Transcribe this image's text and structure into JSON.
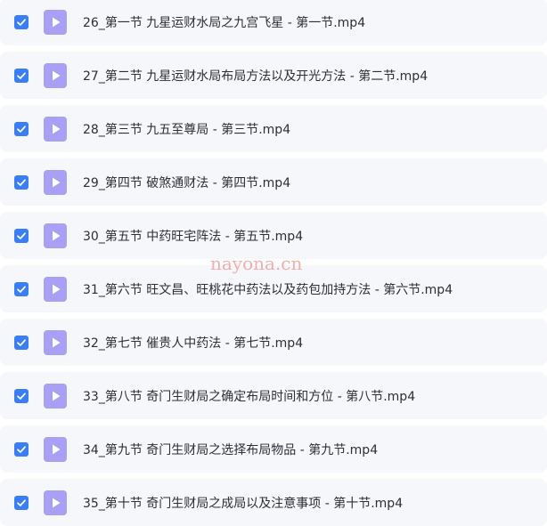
{
  "colors": {
    "row_background": "#f6f7fb",
    "checkbox_checked": "#3a7ef6",
    "video_icon": "#a99ff5",
    "text": "#2b2f36",
    "watermark": "#f3a0a0"
  },
  "files": [
    {
      "name": "26_第一节 九星运财水局之九宫飞星 - 第一节.mp4",
      "checked": true,
      "icon": "video-file-icon"
    },
    {
      "name": "27_第二节 九星运财水局布局方法以及开光方法 - 第二节.mp4",
      "checked": true,
      "icon": "video-file-icon"
    },
    {
      "name": "28_第三节 九五至尊局 - 第三节.mp4",
      "checked": true,
      "icon": "video-file-icon"
    },
    {
      "name": "29_第四节 破煞通财法 - 第四节.mp4",
      "checked": true,
      "icon": "video-file-icon"
    },
    {
      "name": "30_第五节 中药旺宅阵法 - 第五节.mp4",
      "checked": true,
      "icon": "video-file-icon"
    },
    {
      "name": "31_第六节 旺文昌、旺桃花中药法以及药包加持方法 - 第六节.mp4",
      "checked": true,
      "icon": "video-file-icon"
    },
    {
      "name": "32_第七节 催贵人中药法 - 第七节.mp4",
      "checked": true,
      "icon": "video-file-icon"
    },
    {
      "name": "33_第八节 奇门生财局之确定布局时间和方位 - 第八节.mp4",
      "checked": true,
      "icon": "video-file-icon"
    },
    {
      "name": "34_第九节 奇门生财局之选择布局物品 - 第九节.mp4",
      "checked": true,
      "icon": "video-file-icon"
    },
    {
      "name": "35_第十节 奇门生财局之成局以及注意事项 - 第十节.mp4",
      "checked": true,
      "icon": "video-file-icon"
    }
  ],
  "watermark": "nayona.cn"
}
